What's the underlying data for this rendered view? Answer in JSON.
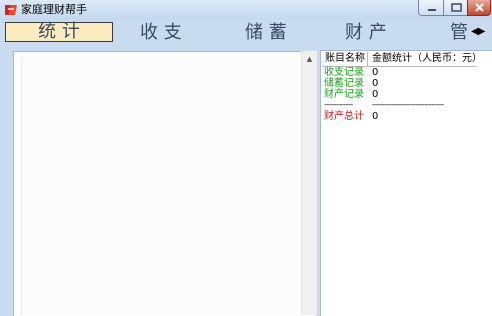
{
  "window": {
    "title": "家庭理财帮手",
    "accent_color": "#c9dcef"
  },
  "tabs": [
    {
      "label": "统  计",
      "active": true
    },
    {
      "label": "收  支",
      "active": false
    },
    {
      "label": "储  蓄",
      "active": false
    },
    {
      "label": "财  产",
      "active": false
    },
    {
      "label": "管",
      "active": false
    }
  ],
  "tab_scroll": {
    "prev_icon": "arrow-left-icon",
    "next_icon": "arrow-right-icon"
  },
  "summary": {
    "col_name": "账目名称",
    "col_amount": "金额统计（人民币：元）",
    "rows": [
      {
        "name": "收支记录",
        "value": "0"
      },
      {
        "name": "储蓄记录",
        "value": "0"
      },
      {
        "name": "财产记录",
        "value": "0"
      }
    ],
    "separator_left": "------------",
    "separator_right": "------------------------------",
    "total_name": "财产总计",
    "total_value": "0",
    "colors": {
      "record": "#1aa51a",
      "total": "#d01818"
    }
  }
}
